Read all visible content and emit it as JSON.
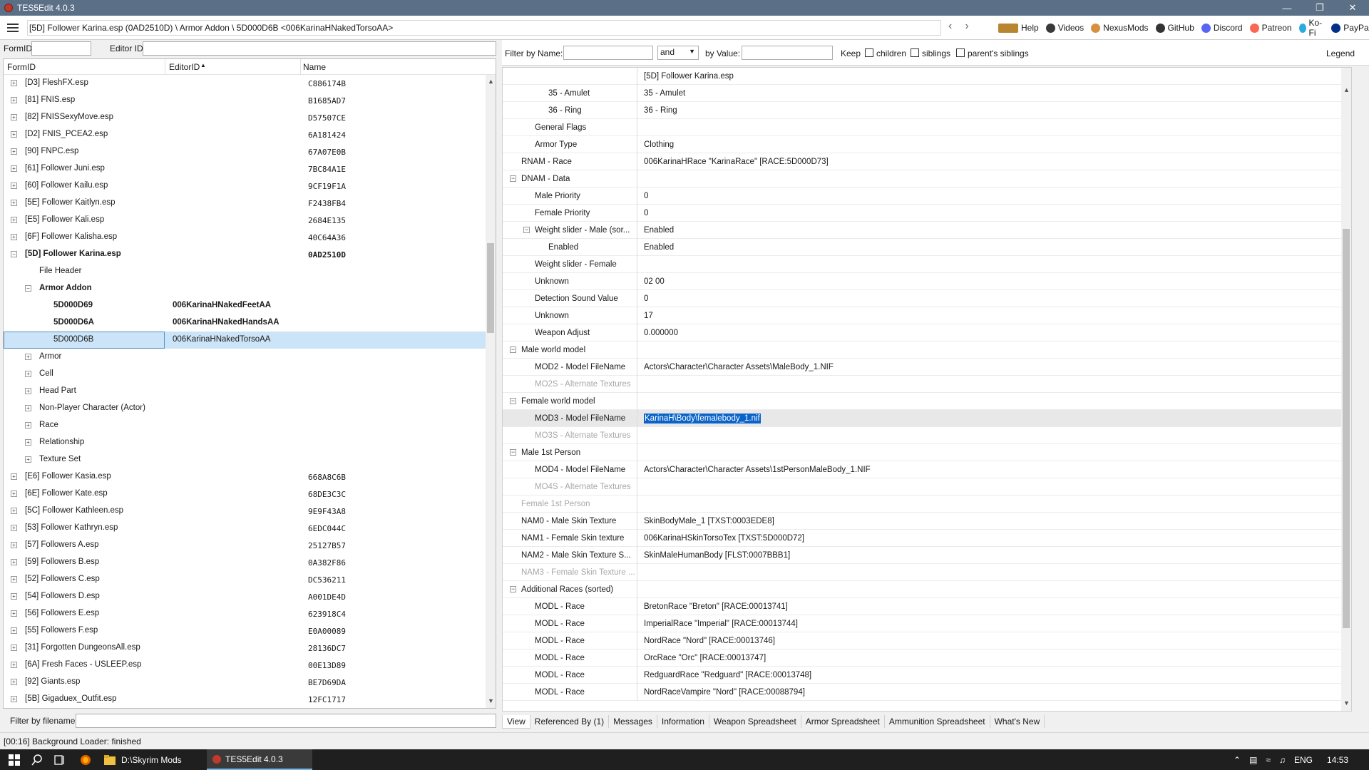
{
  "window": {
    "title": "TES5Edit 4.0.3",
    "controls": [
      "—",
      "❐",
      "✕"
    ]
  },
  "pathbar": {
    "path": "[5D] Follower Karina.esp (0AD2510D) \\ Armor Addon \\ 5D000D6B <006KarinaHNakedTorsoAA>",
    "links": [
      {
        "label": "Help",
        "icon": "book-icon",
        "color": "#b8862e"
      },
      {
        "label": "Videos",
        "icon": "videos-icon",
        "color": "#3a3a3a"
      },
      {
        "label": "NexusMods",
        "icon": "nexusmods-icon",
        "color": "#d98f40"
      },
      {
        "label": "GitHub",
        "icon": "github-icon",
        "color": "#333333"
      },
      {
        "label": "Discord",
        "icon": "discord-icon",
        "color": "#5865f2"
      },
      {
        "label": "Patreon",
        "icon": "patreon-icon",
        "color": "#f96854"
      },
      {
        "label": "Ko-Fi",
        "icon": "kofi-icon",
        "color": "#29abe0"
      },
      {
        "label": "PayPal",
        "icon": "paypal-icon",
        "color": "#003087"
      }
    ]
  },
  "leftfilter": {
    "formid_label": "FormID",
    "formid_value": "",
    "editorid_label": "Editor ID",
    "editorid_value": ""
  },
  "tree": {
    "columns": {
      "formid": "FormID",
      "editorid": "EditorID",
      "name": "Name"
    },
    "rows": [
      {
        "formid": "[D3] FleshFX.esp",
        "edid": "",
        "name": "C886174B",
        "level": 0,
        "exp": "+"
      },
      {
        "formid": "[81] FNIS.esp",
        "edid": "",
        "name": "B1685AD7",
        "level": 0,
        "exp": "+"
      },
      {
        "formid": "[82] FNISSexyMove.esp",
        "edid": "",
        "name": "D57507CE",
        "level": 0,
        "exp": "+"
      },
      {
        "formid": "[D2] FNIS_PCEA2.esp",
        "edid": "",
        "name": "6A181424",
        "level": 0,
        "exp": "+"
      },
      {
        "formid": "[90] FNPC.esp",
        "edid": "",
        "name": "67A07E0B",
        "level": 0,
        "exp": "+"
      },
      {
        "formid": "[61] Follower Juni.esp",
        "edid": "",
        "name": "7BC84A1E",
        "level": 0,
        "exp": "+"
      },
      {
        "formid": "[60] Follower Kailu.esp",
        "edid": "",
        "name": "9CF19F1A",
        "level": 0,
        "exp": "+"
      },
      {
        "formid": "[5E] Follower Kaitlyn.esp",
        "edid": "",
        "name": "F2438FB4",
        "level": 0,
        "exp": "+"
      },
      {
        "formid": "[E5] Follower Kali.esp",
        "edid": "",
        "name": "2684E135",
        "level": 0,
        "exp": "+"
      },
      {
        "formid": "[6F] Follower Kalisha.esp",
        "edid": "",
        "name": "40C64A36",
        "level": 0,
        "exp": "+"
      },
      {
        "formid": "[5D] Follower Karina.esp",
        "edid": "",
        "name": "0AD2510D",
        "level": 0,
        "exp": "-",
        "bold": true
      },
      {
        "formid": "File Header",
        "edid": "",
        "name": "",
        "level": 1,
        "exp": ""
      },
      {
        "formid": "Armor Addon",
        "edid": "",
        "name": "",
        "level": 1,
        "exp": "-",
        "bold": true
      },
      {
        "formid": "5D000D69",
        "edid": "006KarinaHNakedFeetAA",
        "name": "",
        "level": 2,
        "exp": "",
        "bold": true
      },
      {
        "formid": "5D000D6A",
        "edid": "006KarinaHNakedHandsAA",
        "name": "",
        "level": 2,
        "exp": "",
        "bold": true
      },
      {
        "formid": "5D000D6B",
        "edid": "006KarinaHNakedTorsoAA",
        "name": "",
        "level": 2,
        "exp": "",
        "selected": true
      },
      {
        "formid": "Armor",
        "edid": "",
        "name": "",
        "level": 1,
        "exp": "+"
      },
      {
        "formid": "Cell",
        "edid": "",
        "name": "",
        "level": 1,
        "exp": "+"
      },
      {
        "formid": "Head Part",
        "edid": "",
        "name": "",
        "level": 1,
        "exp": "+"
      },
      {
        "formid": "Non-Player Character (Actor)",
        "edid": "",
        "name": "",
        "level": 1,
        "exp": "+"
      },
      {
        "formid": "Race",
        "edid": "",
        "name": "",
        "level": 1,
        "exp": "+"
      },
      {
        "formid": "Relationship",
        "edid": "",
        "name": "",
        "level": 1,
        "exp": "+"
      },
      {
        "formid": "Texture Set",
        "edid": "",
        "name": "",
        "level": 1,
        "exp": "+"
      },
      {
        "formid": "[E6] Follower Kasia.esp",
        "edid": "",
        "name": "668A8C6B",
        "level": 0,
        "exp": "+"
      },
      {
        "formid": "[6E] Follower Kate.esp",
        "edid": "",
        "name": "68DE3C3C",
        "level": 0,
        "exp": "+"
      },
      {
        "formid": "[5C] Follower Kathleen.esp",
        "edid": "",
        "name": "9E9F43A8",
        "level": 0,
        "exp": "+"
      },
      {
        "formid": "[53] Follower Kathryn.esp",
        "edid": "",
        "name": "6EDC044C",
        "level": 0,
        "exp": "+"
      },
      {
        "formid": "[57] Followers A.esp",
        "edid": "",
        "name": "25127B57",
        "level": 0,
        "exp": "+"
      },
      {
        "formid": "[59] Followers B.esp",
        "edid": "",
        "name": "0A382F86",
        "level": 0,
        "exp": "+"
      },
      {
        "formid": "[52] Followers C.esp",
        "edid": "",
        "name": "DC536211",
        "level": 0,
        "exp": "+"
      },
      {
        "formid": "[54] Followers D.esp",
        "edid": "",
        "name": "A001DE4D",
        "level": 0,
        "exp": "+"
      },
      {
        "formid": "[56] Followers E.esp",
        "edid": "",
        "name": "623918C4",
        "level": 0,
        "exp": "+"
      },
      {
        "formid": "[55] Followers F.esp",
        "edid": "",
        "name": "E0A00089",
        "level": 0,
        "exp": "+"
      },
      {
        "formid": "[31] Forgotten DungeonsAll.esp",
        "edid": "",
        "name": "28136DC7",
        "level": 0,
        "exp": "+"
      },
      {
        "formid": "[6A] Fresh Faces - USLEEP.esp",
        "edid": "",
        "name": "00E13D89",
        "level": 0,
        "exp": "+"
      },
      {
        "formid": "[92] Giants.esp",
        "edid": "",
        "name": "BE7D69DA",
        "level": 0,
        "exp": "+"
      },
      {
        "formid": "[5B] Gigaduex_Outfit.esp",
        "edid": "",
        "name": "12FC1717",
        "level": 0,
        "exp": "+"
      }
    ]
  },
  "filename_filter": {
    "label": "Filter by filename:",
    "value": ""
  },
  "rightfilter": {
    "by_name_label": "Filter by Name:",
    "by_name_value": "",
    "op_value": "and",
    "by_value_label": "by Value:",
    "by_value_value": "",
    "keep_label": "Keep",
    "children_label": "children",
    "siblings_label": "siblings",
    "parents_siblings_label": "parent's siblings",
    "legend_label": "Legend"
  },
  "view": {
    "header_value": "[5D] Follower Karina.esp",
    "rows": [
      {
        "label": "35 - Amulet",
        "value": "35 - Amulet",
        "indent": 3
      },
      {
        "label": "36 - Ring",
        "value": "36 - Ring",
        "indent": 3
      },
      {
        "label": "General Flags",
        "value": "",
        "indent": 2
      },
      {
        "label": "Armor Type",
        "value": "Clothing",
        "indent": 2
      },
      {
        "label": "RNAM - Race",
        "value": "006KarinaHRace \"KarinaRace\" [RACE:5D000D73]",
        "indent": 1
      },
      {
        "label": "DNAM - Data",
        "value": "",
        "indent": 1,
        "exp": "-"
      },
      {
        "label": "Male Priority",
        "value": "0",
        "indent": 2
      },
      {
        "label": "Female Priority",
        "value": "0",
        "indent": 2
      },
      {
        "label": "Weight slider - Male (sor...",
        "value": "Enabled",
        "indent": 2,
        "exp": "-"
      },
      {
        "label": "Enabled",
        "value": "Enabled",
        "indent": 3
      },
      {
        "label": "Weight slider - Female",
        "value": "",
        "indent": 2
      },
      {
        "label": "Unknown",
        "value": "02 00",
        "indent": 2
      },
      {
        "label": "Detection Sound Value",
        "value": "0",
        "indent": 2
      },
      {
        "label": "Unknown",
        "value": "17",
        "indent": 2
      },
      {
        "label": "Weapon Adjust",
        "value": "0.000000",
        "indent": 2
      },
      {
        "label": "Male world model",
        "value": "",
        "indent": 1,
        "exp": "-"
      },
      {
        "label": "MOD2 - Model FileName",
        "value": "Actors\\Character\\Character Assets\\MaleBody_1.NIF",
        "indent": 2
      },
      {
        "label": "MO2S - Alternate Textures",
        "value": "",
        "indent": 2,
        "grey": true
      },
      {
        "label": "Female world model",
        "value": "",
        "indent": 1,
        "exp": "-"
      },
      {
        "label": "MOD3 - Model FileName",
        "value": "KarinaH\\Body\\femalebody_1.nif",
        "indent": 2,
        "hl": true
      },
      {
        "label": "MO3S - Alternate Textures",
        "value": "",
        "indent": 2,
        "grey": true
      },
      {
        "label": "Male 1st Person",
        "value": "",
        "indent": 1,
        "exp": "-"
      },
      {
        "label": "MOD4 - Model FileName",
        "value": "Actors\\Character\\Character Assets\\1stPersonMaleBody_1.NIF",
        "indent": 2
      },
      {
        "label": "MO4S - Alternate Textures",
        "value": "",
        "indent": 2,
        "grey": true
      },
      {
        "label": "Female 1st Person",
        "value": "",
        "indent": 1,
        "grey": true
      },
      {
        "label": "NAM0 - Male Skin Texture",
        "value": "SkinBodyMale_1 [TXST:0003EDE8]",
        "indent": 1
      },
      {
        "label": "NAM1 - Female Skin texture",
        "value": "006KarinaHSkinTorsoTex [TXST:5D000D72]",
        "indent": 1
      },
      {
        "label": "NAM2 - Male Skin Texture S...",
        "value": "SkinMaleHumanBody [FLST:0007BBB1]",
        "indent": 1
      },
      {
        "label": "NAM3 - Female Skin Texture ...",
        "value": "",
        "indent": 1,
        "grey": true
      },
      {
        "label": "Additional Races (sorted)",
        "value": "",
        "indent": 1,
        "exp": "-"
      },
      {
        "label": "MODL - Race",
        "value": "BretonRace \"Breton\" [RACE:00013741]",
        "indent": 2
      },
      {
        "label": "MODL - Race",
        "value": "ImperialRace \"Imperial\" [RACE:00013744]",
        "indent": 2
      },
      {
        "label": "MODL - Race",
        "value": "NordRace \"Nord\" [RACE:00013746]",
        "indent": 2
      },
      {
        "label": "MODL - Race",
        "value": "OrcRace \"Orc\" [RACE:00013747]",
        "indent": 2
      },
      {
        "label": "MODL - Race",
        "value": "RedguardRace \"Redguard\" [RACE:00013748]",
        "indent": 2
      },
      {
        "label": "MODL - Race",
        "value": "NordRaceVampire \"Nord\" [RACE:00088794]",
        "indent": 2
      }
    ]
  },
  "tabs": [
    "View",
    "Referenced By (1)",
    "Messages",
    "Information",
    "Weapon Spreadsheet",
    "Armor Spreadsheet",
    "Ammunition Spreadsheet",
    "What's New"
  ],
  "status": "[00:16] Background Loader: finished",
  "taskbar": {
    "items": [
      {
        "label": "D:\\Skyrim Mods",
        "icon": "folder-icon"
      },
      {
        "label": "TES5Edit 4.0.3",
        "icon": "tes5edit-icon"
      }
    ],
    "tray": {
      "lang": "ENG",
      "time": "14:53"
    }
  }
}
